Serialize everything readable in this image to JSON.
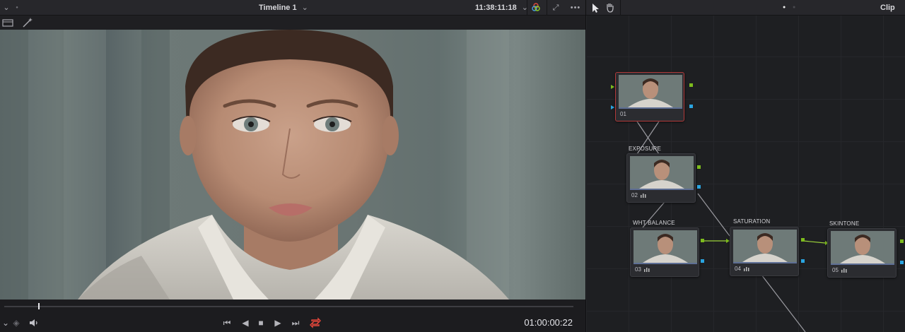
{
  "topbar": {
    "timeline_title": "Timeline 1",
    "timecode": "11:38:11:18",
    "right_label": "Clip"
  },
  "viewer": {
    "timecode": "01:00:00:22",
    "playhead_fraction": 0.06
  },
  "nodes": [
    {
      "number": "01",
      "label": "",
      "selected": true
    },
    {
      "number": "02",
      "label": "EXPOSURE",
      "selected": false
    },
    {
      "number": "03",
      "label": "WHT BALANCE",
      "selected": false
    },
    {
      "number": "04",
      "label": "SATURATION",
      "selected": false
    },
    {
      "number": "05",
      "label": "SKINTONE",
      "selected": false
    }
  ],
  "colors": {
    "selected_node_border": "#b13a3a",
    "rgb_port": "#7dbb1d",
    "key_port": "#2aa4e0",
    "loop_active": "#e5473b"
  },
  "icons": {
    "menu": "chevron-down-icon",
    "dual_view": "window-icon",
    "magic": "magic-wand-icon",
    "color_wheel": "color-wheels-icon",
    "fullscreen": "expand-icon",
    "more": "ellipsis-icon",
    "pointer": "pointer-icon",
    "hand": "hand-icon"
  }
}
